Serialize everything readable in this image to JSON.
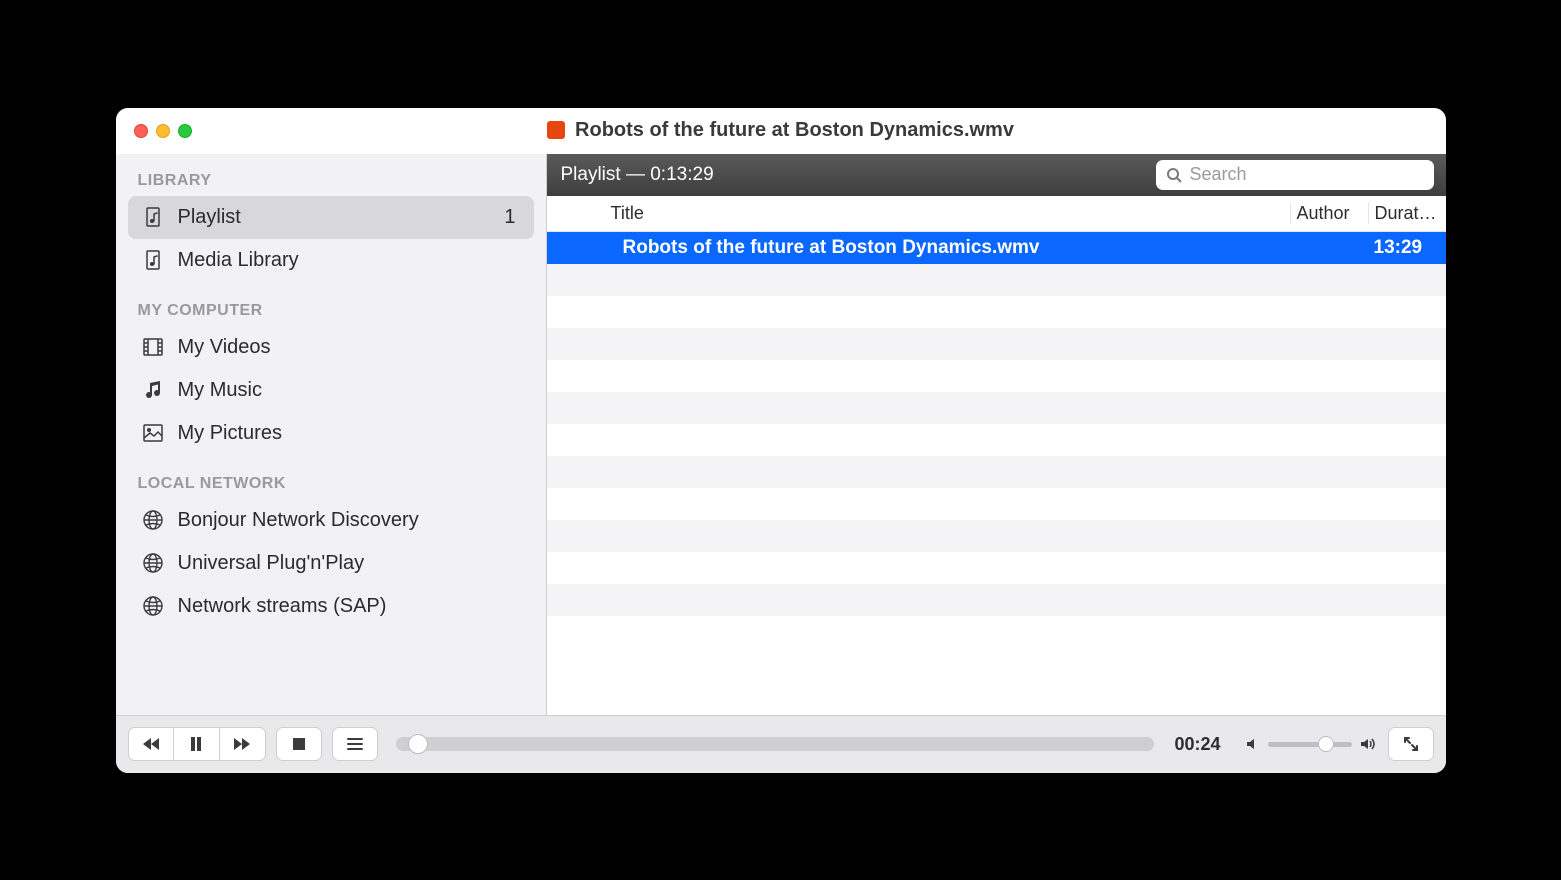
{
  "window": {
    "title": "Robots of the future at Boston Dynamics.wmv"
  },
  "sidebar": {
    "sections": [
      {
        "label": "LIBRARY",
        "items": [
          {
            "icon": "playlist-icon",
            "label": "Playlist",
            "count": "1",
            "selected": true
          },
          {
            "icon": "playlist-icon",
            "label": "Media Library"
          }
        ]
      },
      {
        "label": "MY COMPUTER",
        "items": [
          {
            "icon": "film-icon",
            "label": "My Videos"
          },
          {
            "icon": "music-icon",
            "label": "My Music"
          },
          {
            "icon": "pictures-icon",
            "label": "My Pictures"
          }
        ]
      },
      {
        "label": "LOCAL NETWORK",
        "items": [
          {
            "icon": "globe-icon",
            "label": "Bonjour Network Discovery"
          },
          {
            "icon": "globe-icon",
            "label": "Universal Plug'n'Play"
          },
          {
            "icon": "globe-icon",
            "label": "Network streams (SAP)"
          }
        ]
      }
    ]
  },
  "main": {
    "header_title": "Playlist — 0:13:29",
    "search_placeholder": "Search",
    "columns": {
      "title": "Title",
      "author": "Author",
      "duration": "Durat…"
    },
    "rows": [
      {
        "title": "Robots of the future at Boston Dynamics.wmv",
        "author": "",
        "duration": "13:29",
        "selected": true
      }
    ],
    "empty_row_count": 12
  },
  "footer": {
    "elapsed": "00:24",
    "progress_percent": 3,
    "volume_percent": 70
  }
}
